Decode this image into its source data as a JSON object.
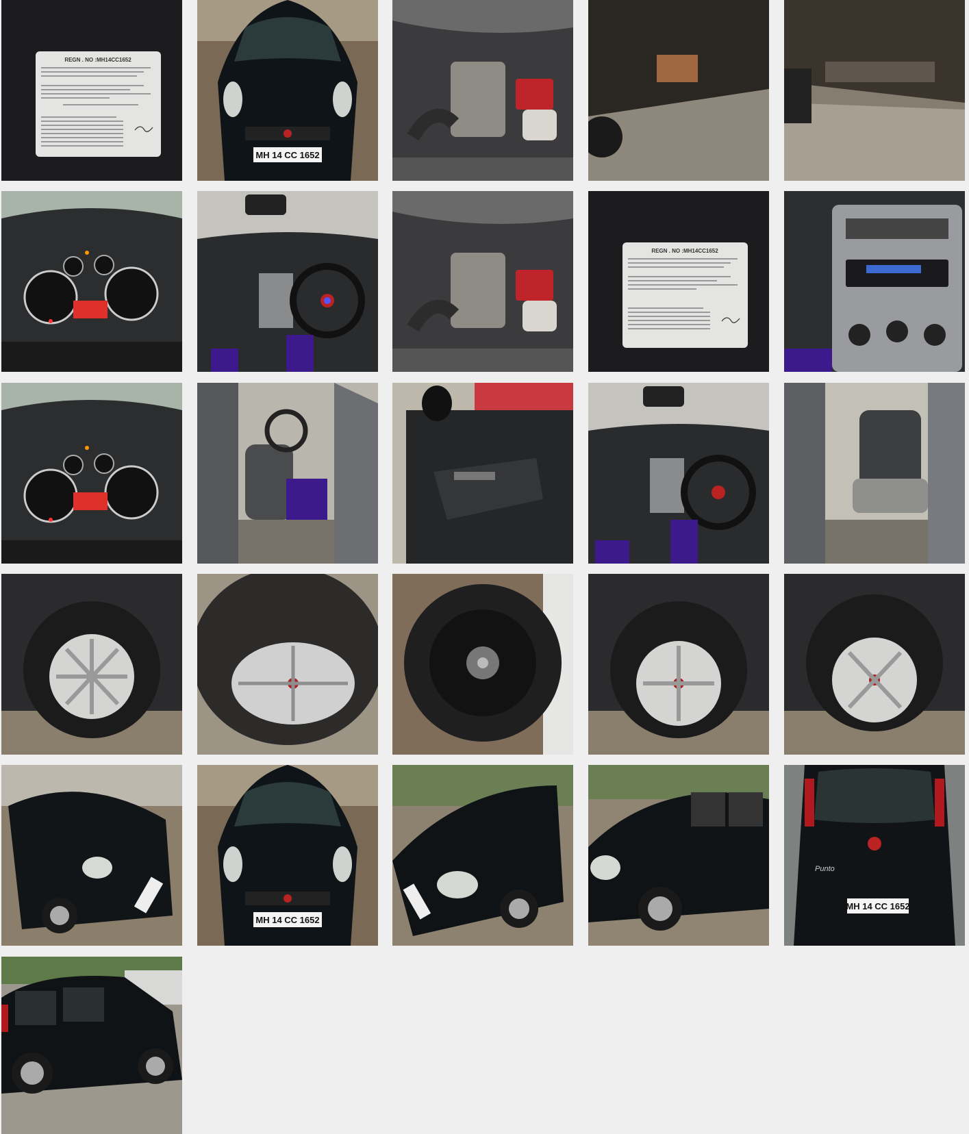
{
  "gallery": {
    "regn_card": {
      "title": "REGN . NO :MH14CC1652",
      "rows": [
        "REG. DT   01/06/2010        O.SNo    01",
        "CH. NO   MCA11825007014724DNZ   MFG CO   FIATIL",
        "E.NO    7050022          COLOUR   H P BLACK",
        "                          CLASS    LMV",
        "NAME    MR SAURABH BHATT",
        "S/W/D OF  SRIJMOHAN",
        "ADDRESS  FLAT NO C1 301 NISARG NIRMITI SOCY",
        "         PIMPLE SAUDAGAR",
        "          PUNE             411027",
        "HP/LEASE  HDFC BANK LTD",
        "MODEL   GRANDE PUNTO1.2FIRE DYNAMIC",
        "BODY    SALOON     NO. OF CYL   4",
        "WHEEL BASE        UNLADEN WT   1140",
        "MFG.DT  04/2010   SEATING C    5",
        "FUEL    PETROL    STANDING C   0",
        "REG UPTO 31/05/2025 CC/CAP     1172",
        "TAX UPTO LTT      CARD SLNO  140237432"
      ],
      "authority": [
        "Registering Authority",
        "Dy. R. T. O.",
        "Pimpri Chinchwad"
      ],
      "signature_label": "Signature"
    },
    "plate_front": "MH 14 CC 1652",
    "plate_rear": "MH 14 CC 1652",
    "rear_badge": "Punto"
  }
}
